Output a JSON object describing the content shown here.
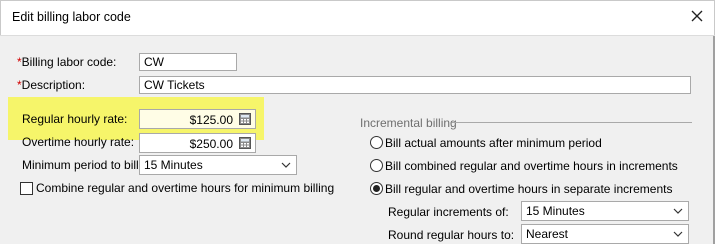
{
  "window": {
    "title": "Edit billing labor code"
  },
  "form": {
    "required_marker": "*",
    "billing_labor_code": {
      "label": "Billing labor code:",
      "value": "CW"
    },
    "description": {
      "label": "Description:",
      "value": "CW Tickets"
    },
    "regular_hourly_rate": {
      "label": "Regular hourly rate:",
      "value": "$125.00"
    },
    "overtime_hourly_rate": {
      "label": "Overtime hourly rate:",
      "value": "$250.00"
    },
    "minimum_period": {
      "label": "Minimum period to bill:",
      "value": "15  Minutes"
    },
    "combine_checkbox": {
      "label": "Combine regular and overtime hours for minimum billing",
      "checked": false
    }
  },
  "incremental_billing": {
    "title": "Incremental billing",
    "options": [
      {
        "label": "Bill actual amounts after minimum period",
        "selected": false
      },
      {
        "label": "Bill combined regular and overtime hours in increments",
        "selected": false
      },
      {
        "label": "Bill regular and overtime hours in separate increments",
        "selected": true
      }
    ],
    "regular_increments": {
      "label": "Regular increments of:",
      "value": "15  Minutes"
    },
    "round_regular_hours": {
      "label": "Round regular hours to:",
      "value": "Nearest"
    }
  },
  "colors": {
    "highlight": "#f6f56a",
    "required": "#d20000",
    "money_field_bg": "#fffde6"
  },
  "icons": {
    "close": "close-icon",
    "calculator": "calculator-icon",
    "dropdown": "chevron-down-icon"
  }
}
